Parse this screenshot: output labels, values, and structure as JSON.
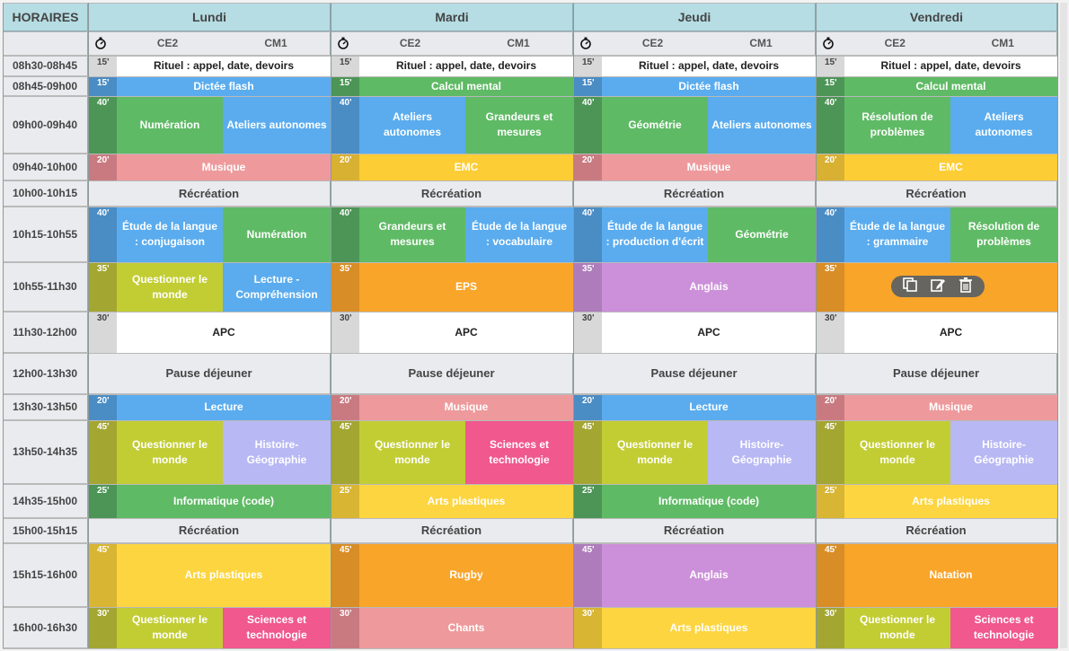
{
  "header": {
    "corner": "HORAIRES",
    "days": [
      "Lundi",
      "Mardi",
      "Jeudi",
      "Vendredi"
    ]
  },
  "subheader": {
    "timer_icon": "stopwatch-icon",
    "levels": [
      "CE2",
      "CM1"
    ]
  },
  "colors": {
    "flash": "#5aacee",
    "mental": "#5fba65",
    "musique": "#ee9a9c",
    "emc": "#fdcd35",
    "green": "#5fba65",
    "blue": "#5aacee",
    "lime": "#c2cd34",
    "orange": "#f9a52a",
    "violet": "#cc8fd9",
    "yellow": "#fdd540",
    "pink": "#f0588e",
    "white": "#ffffff"
  },
  "slots": [
    {
      "time": "08h30-08h45",
      "days": [
        {
          "dur": "15'",
          "color": "white",
          "full": "Rituel : appel, date, devoirs"
        },
        {
          "dur": "15'",
          "color": "white",
          "full": "Rituel : appel, date, devoirs"
        },
        {
          "dur": "15'",
          "color": "white",
          "full": "Rituel : appel, date, devoirs"
        },
        {
          "dur": "15'",
          "color": "white",
          "full": "Rituel : appel, date, devoirs"
        }
      ]
    },
    {
      "time": "08h45-09h00",
      "days": [
        {
          "dur": "15'",
          "color": "blue",
          "full": "Dictée flash"
        },
        {
          "dur": "15'",
          "color": "green",
          "full": "Calcul mental"
        },
        {
          "dur": "15'",
          "color": "blue",
          "full": "Dictée flash"
        },
        {
          "dur": "15'",
          "color": "green",
          "full": "Calcul mental"
        }
      ]
    },
    {
      "time": "09h00-09h40",
      "days": [
        {
          "dur": "40'",
          "color": "green",
          "ce2": {
            "t": "Numération",
            "c": "green"
          },
          "cm1": {
            "t": "Ateliers autonomes",
            "c": "blue"
          }
        },
        {
          "dur": "40'",
          "color": "blue",
          "ce2": {
            "t": "Ateliers autonomes",
            "c": "blue"
          },
          "cm1": {
            "t": "Grandeurs et mesures",
            "c": "green"
          }
        },
        {
          "dur": "40'",
          "color": "green",
          "ce2": {
            "t": "Géométrie",
            "c": "green"
          },
          "cm1": {
            "t": "Ateliers autonomes",
            "c": "blue"
          }
        },
        {
          "dur": "40'",
          "color": "green",
          "ce2": {
            "t": "Résolution de problèmes",
            "c": "green"
          },
          "cm1": {
            "t": "Ateliers autonomes",
            "c": "blue"
          }
        }
      ]
    },
    {
      "time": "09h40-10h00",
      "days": [
        {
          "dur": "20'",
          "color": "musique",
          "full": "Musique"
        },
        {
          "dur": "20'",
          "color": "emc",
          "full": "EMC"
        },
        {
          "dur": "20'",
          "color": "musique",
          "full": "Musique"
        },
        {
          "dur": "20'",
          "color": "emc",
          "full": "EMC"
        }
      ]
    },
    {
      "time": "10h00-10h15",
      "recess": "Récréation"
    },
    {
      "time": "10h15-10h55",
      "days": [
        {
          "dur": "40'",
          "color": "blue",
          "ce2": {
            "t": "Étude de la langue : conjugaison",
            "c": "blue"
          },
          "cm1": {
            "t": "Numération",
            "c": "green"
          }
        },
        {
          "dur": "40'",
          "color": "green",
          "ce2": {
            "t": "Grandeurs et mesures",
            "c": "green"
          },
          "cm1": {
            "t": "Étude de la langue : vocabulaire",
            "c": "blue"
          }
        },
        {
          "dur": "40'",
          "color": "blue",
          "ce2": {
            "t": "Étude de la langue : production d'écrit",
            "c": "blue"
          },
          "cm1": {
            "t": "Géométrie",
            "c": "green"
          }
        },
        {
          "dur": "40'",
          "color": "blue",
          "ce2": {
            "t": "Étude de la langue : grammaire",
            "c": "blue"
          },
          "cm1": {
            "t": "Résolution de problèmes",
            "c": "green"
          }
        }
      ]
    },
    {
      "time": "10h55-11h30",
      "days": [
        {
          "dur": "35'",
          "color": "lime",
          "ce2": {
            "t": "Questionner le monde",
            "c": "lime"
          },
          "cm1": {
            "t": "Lecture - Compréhension",
            "c": "blue"
          }
        },
        {
          "dur": "35'",
          "color": "orange",
          "full": "EPS"
        },
        {
          "dur": "35'",
          "color": "violet",
          "full": "Anglais"
        },
        {
          "dur": "35'",
          "color": "orange",
          "full": ""
        }
      ]
    },
    {
      "time": "11h30-12h00",
      "days": [
        {
          "dur": "30'",
          "color": "white",
          "full": "APC"
        },
        {
          "dur": "30'",
          "color": "white",
          "full": "APC"
        },
        {
          "dur": "30'",
          "color": "white",
          "full": "APC"
        },
        {
          "dur": "30'",
          "color": "white",
          "full": "APC"
        }
      ]
    },
    {
      "time": "12h00-13h30",
      "recess": "Pause déjeuner"
    },
    {
      "time": "13h30-13h50",
      "days": [
        {
          "dur": "20'",
          "color": "blue",
          "full": "Lecture"
        },
        {
          "dur": "20'",
          "color": "musique",
          "full": "Musique"
        },
        {
          "dur": "20'",
          "color": "blue",
          "full": "Lecture"
        },
        {
          "dur": "20'",
          "color": "musique",
          "full": "Musique"
        }
      ]
    },
    {
      "time": "13h50-14h35",
      "days": [
        {
          "dur": "45'",
          "color": "lime",
          "ce2": {
            "t": "Questionner le monde",
            "c": "lime"
          },
          "cm1": {
            "t": "Histoire-Géographie",
            "c": "lavender"
          }
        },
        {
          "dur": "45'",
          "color": "lime",
          "ce2": {
            "t": "Questionner le monde",
            "c": "lime"
          },
          "cm1": {
            "t": "Sciences et technologie",
            "c": "pink"
          }
        },
        {
          "dur": "45'",
          "color": "lime",
          "ce2": {
            "t": "Questionner le monde",
            "c": "lime"
          },
          "cm1": {
            "t": "Histoire-Géographie",
            "c": "lavender"
          }
        },
        {
          "dur": "45'",
          "color": "lime",
          "ce2": {
            "t": "Questionner le monde",
            "c": "lime"
          },
          "cm1": {
            "t": "Histoire-Géographie",
            "c": "lavender"
          }
        }
      ]
    },
    {
      "time": "14h35-15h00",
      "days": [
        {
          "dur": "25'",
          "color": "green",
          "full": "Informatique (code)"
        },
        {
          "dur": "25'",
          "color": "yellow",
          "full": "Arts plastiques"
        },
        {
          "dur": "25'",
          "color": "green",
          "full": "Informatique (code)"
        },
        {
          "dur": "25'",
          "color": "yellow",
          "full": "Arts plastiques"
        }
      ]
    },
    {
      "time": "15h00-15h15",
      "recess": "Récréation"
    },
    {
      "time": "15h15-16h00",
      "days": [
        {
          "dur": "45'",
          "color": "yellow",
          "full": "Arts plastiques"
        },
        {
          "dur": "45'",
          "color": "orange",
          "full": "Rugby"
        },
        {
          "dur": "45'",
          "color": "violet",
          "full": "Anglais"
        },
        {
          "dur": "45'",
          "color": "orange",
          "full": "Natation"
        }
      ]
    },
    {
      "time": "16h00-16h30",
      "days": [
        {
          "dur": "30'",
          "color": "lime",
          "ce2": {
            "t": "Questionner le monde",
            "c": "lime"
          },
          "cm1": {
            "t": "Sciences et technologie",
            "c": "pink"
          }
        },
        {
          "dur": "30'",
          "color": "musique",
          "full": "Chants"
        },
        {
          "dur": "30'",
          "color": "yellow",
          "full": "Arts plastiques"
        },
        {
          "dur": "30'",
          "color": "lime",
          "ce2": {
            "t": "Questionner le monde",
            "c": "lime"
          },
          "cm1": {
            "t": "Sciences et technologie",
            "c": "pink"
          }
        }
      ]
    }
  ],
  "overlay": {
    "icons": [
      "duplicate-icon",
      "edit-icon",
      "delete-icon"
    ]
  }
}
